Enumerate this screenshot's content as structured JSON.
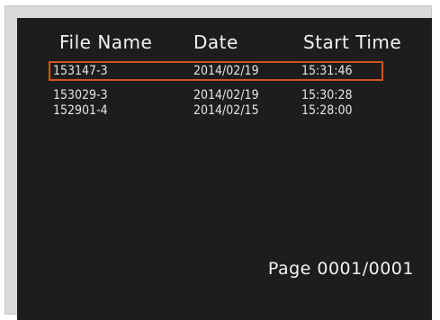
{
  "header": {
    "file_name": "File Name",
    "date": "Date",
    "start_time": "Start Time"
  },
  "rows": [
    {
      "file_name": "153147-3",
      "date": "2014/02/19",
      "start_time": "15:31:46",
      "selected": true
    },
    {
      "file_name": "153029-3",
      "date": "2014/02/19",
      "start_time": "15:30:28",
      "selected": false
    },
    {
      "file_name": "152901-4",
      "date": "2014/02/15",
      "start_time": "15:28:00",
      "selected": false
    }
  ],
  "pagination": {
    "label": "Page 0001/0001"
  },
  "colors": {
    "background": "#1d1d1d",
    "text": "#f2f2f2",
    "selection_border": "#d0551f"
  }
}
